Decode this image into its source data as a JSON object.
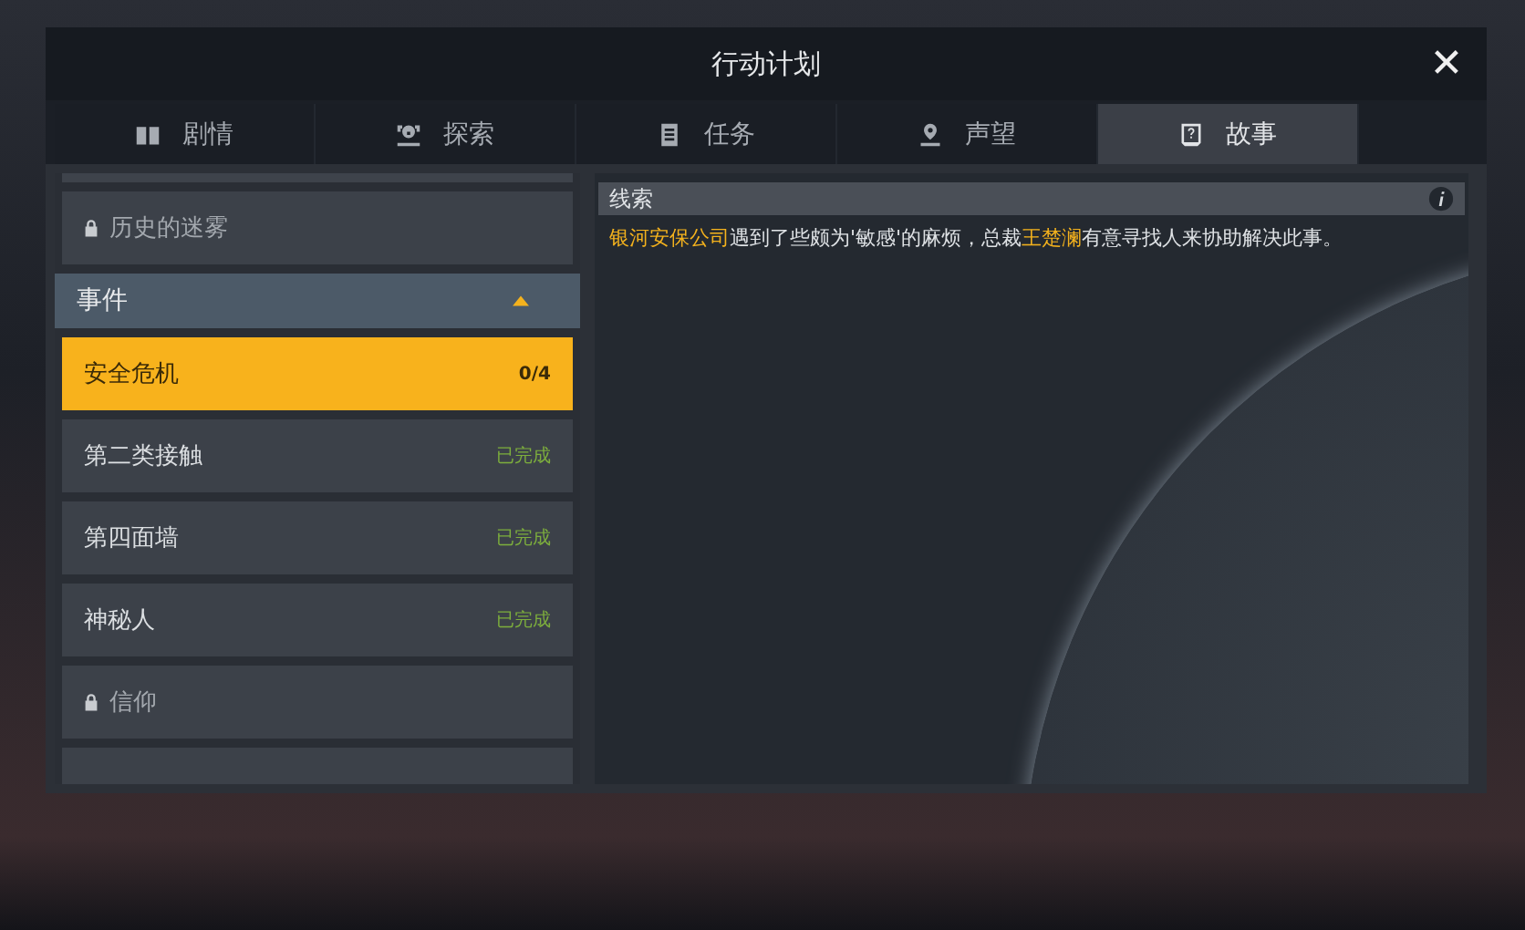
{
  "window": {
    "title": "行动计划",
    "close_label": "✕"
  },
  "tabs": [
    {
      "label": "剧情",
      "selected": false
    },
    {
      "label": "探索",
      "selected": false
    },
    {
      "label": "任务",
      "selected": false
    },
    {
      "label": "声望",
      "selected": false
    },
    {
      "label": "故事",
      "selected": true
    }
  ],
  "sidebar": {
    "items": [
      {
        "kind": "locked",
        "label": "历史的迷雾"
      },
      {
        "kind": "group",
        "label": "事件",
        "expanded": true
      },
      {
        "kind": "quest",
        "label": "安全危机",
        "status": "0/4",
        "selected": true,
        "completed": false
      },
      {
        "kind": "quest",
        "label": "第二类接触",
        "status": "已完成",
        "selected": false,
        "completed": true
      },
      {
        "kind": "quest",
        "label": "第四面墙",
        "status": "已完成",
        "selected": false,
        "completed": true
      },
      {
        "kind": "quest",
        "label": "神秘人",
        "status": "已完成",
        "selected": false,
        "completed": true
      },
      {
        "kind": "locked",
        "label": "信仰"
      }
    ]
  },
  "clue": {
    "title": "线索",
    "text": [
      {
        "s": "银河安保公司",
        "highlight": true
      },
      {
        "s": "遇到了些颇为'敏感'的麻烦，总裁",
        "highlight": false
      },
      {
        "s": "王楚澜",
        "highlight": true
      },
      {
        "s": "有意寻找人来协助解决此事。",
        "highlight": false
      }
    ]
  }
}
